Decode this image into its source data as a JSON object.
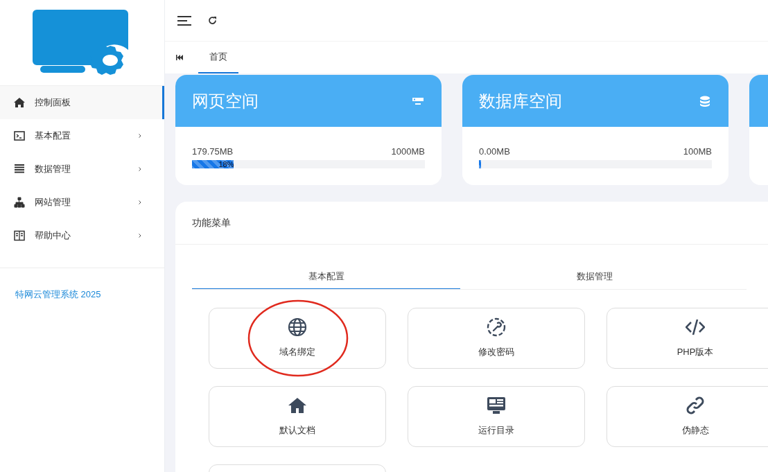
{
  "sidebar": {
    "items": [
      {
        "label": "控制面板",
        "selected": true,
        "has_submenu": false
      },
      {
        "label": "基本配置",
        "selected": false,
        "has_submenu": true
      },
      {
        "label": "数据管理",
        "selected": false,
        "has_submenu": true
      },
      {
        "label": "网站管理",
        "selected": false,
        "has_submenu": true
      },
      {
        "label": "帮助中心",
        "selected": false,
        "has_submenu": true
      }
    ],
    "footer": "特网云管理系统 2025"
  },
  "page_tabs": [
    {
      "label": "首页",
      "selected": true
    }
  ],
  "stat_cards": [
    {
      "title": "网页空间",
      "used": "179.75MB",
      "total": "1000MB",
      "level": 0.18,
      "percent_label": "18%"
    },
    {
      "title": "数据库空间",
      "used": "0.00MB",
      "total": "100MB",
      "level": 0.01
    }
  ],
  "function_menu": {
    "title": "功能菜单",
    "tabs": [
      {
        "label": "基本配置",
        "selected": true
      },
      {
        "label": "数据管理",
        "selected": false
      }
    ],
    "items": [
      {
        "label": "域名绑定",
        "annotated": true
      },
      {
        "label": "修改密码"
      },
      {
        "label": "PHP版本"
      },
      {
        "label": "默认文档"
      },
      {
        "label": "运行目录"
      },
      {
        "label": "伪静态"
      }
    ]
  }
}
